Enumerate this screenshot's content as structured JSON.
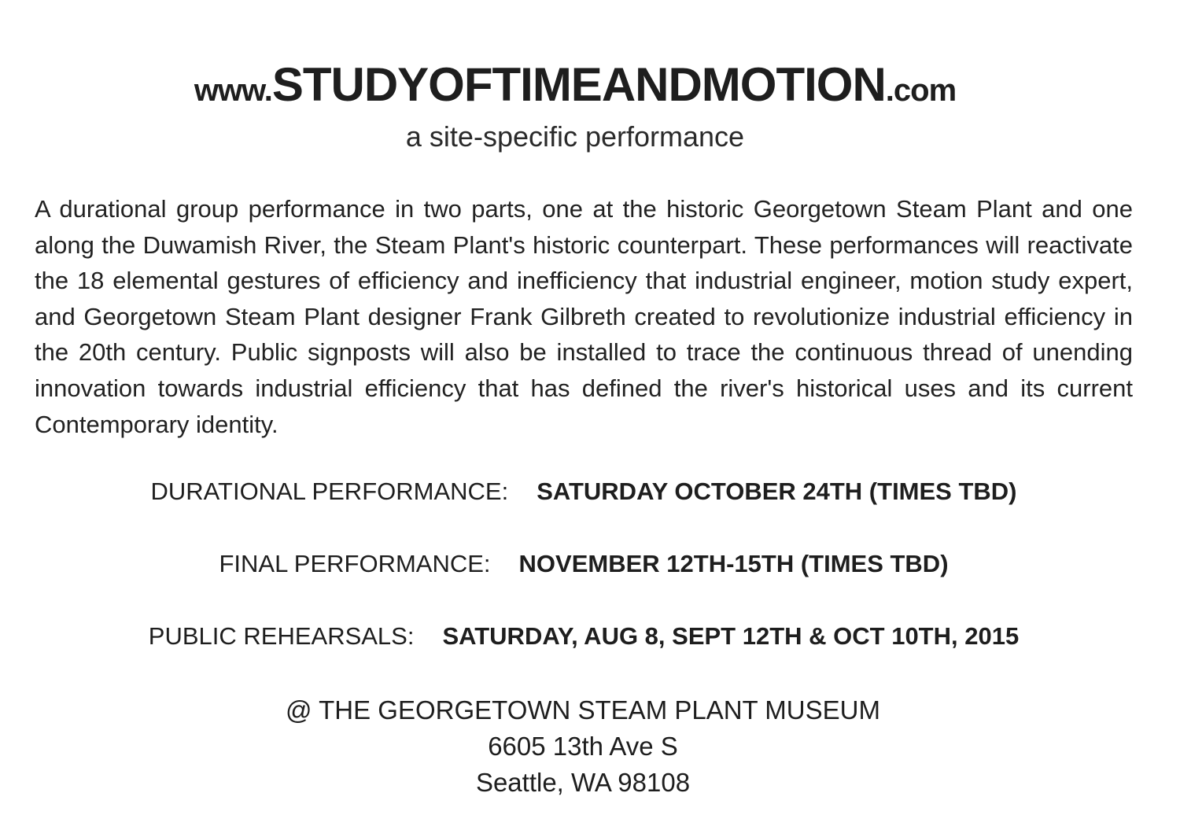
{
  "header": {
    "prefix": "www.",
    "main": "STUDYOFTIMEANDMOTION",
    "suffix": ".com",
    "subtitle": "a site-specific performance"
  },
  "description": "A durational group performance in two parts, one at the historic Georgetown Steam Plant and one along the Duwamish River, the Steam Plant's historic counterpart. These performances will reactivate the 18 elemental gestures of efficiency and inefficiency that industrial engineer, motion study expert, and Georgetown Steam Plant designer Frank Gilbreth created to revolutionize industrial efficiency in the 20th century. Public signposts will also be installed to trace the continuous thread of unending innovation towards industrial efficiency that has defined the river's historical uses and its current Contemporary identity.",
  "schedule": [
    {
      "label": "DURATIONAL PERFORMANCE:",
      "value": "SATURDAY OCTOBER 24TH (TIMES TBD)"
    },
    {
      "label": "FINAL PERFORMANCE:",
      "value": "NOVEMBER 12TH-15TH (TIMES TBD)"
    },
    {
      "label": "PUBLIC REHEARSALS:",
      "value": "SATURDAY, AUG 8, SEPT 12TH & OCT 10TH, 2015"
    }
  ],
  "venue": {
    "name": "@ THE GEORGETOWN STEAM PLANT MUSEUM",
    "street": "6605 13th Ave S",
    "city": "Seattle, WA 98108"
  }
}
